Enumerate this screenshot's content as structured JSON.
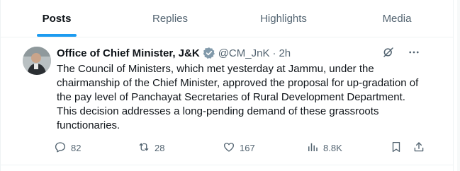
{
  "tabs": [
    {
      "label": "Posts",
      "active": true
    },
    {
      "label": "Replies",
      "active": false
    },
    {
      "label": "Highlights",
      "active": false
    },
    {
      "label": "Media",
      "active": false
    }
  ],
  "post": {
    "author_name": "Office of Chief Minister, J&K",
    "handle": "@CM_JnK",
    "separator": "·",
    "time": "2h",
    "verified_badge_color": "#829aab",
    "body": "The Council of Ministers, which met yesterday at Jammu, under the chairmanship of the Chief Minister, approved the proposal for up-gradation of the pay level of Panchayat Secretaries of Rural Development Department. This decision addresses a long-pending demand of these grassroots functionaries.",
    "stats": {
      "replies": "82",
      "reposts": "28",
      "likes": "167",
      "views": "8.8K"
    }
  },
  "colors": {
    "accent": "#1d9bf0",
    "muted_text": "#536471",
    "primary_text": "#0f1419",
    "divider": "#eff3f4"
  }
}
